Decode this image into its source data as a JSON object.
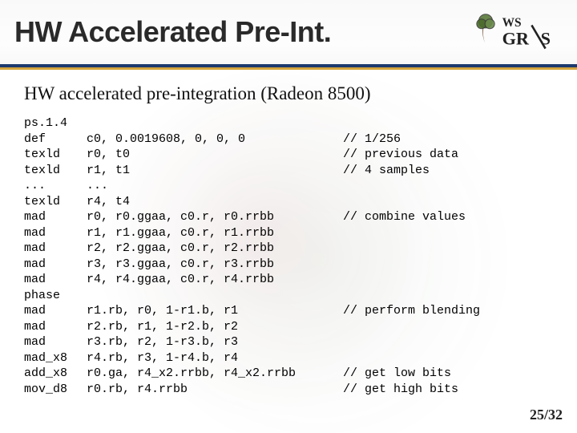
{
  "header": {
    "title": "HW Accelerated Pre-Int.",
    "logo_alt": "WS GRS"
  },
  "subtitle": "HW accelerated pre-integration (Radeon 8500)",
  "code": {
    "rows": [
      {
        "op": "ps.1.4",
        "args": "",
        "cm": ""
      },
      {
        "op": "def",
        "args": "c0, 0.0019608, 0, 0, 0",
        "cm": "// 1/256"
      },
      {
        "op": "texld",
        "args": "r0, t0",
        "cm": "// previous data"
      },
      {
        "op": "texld",
        "args": "r1, t1",
        "cm": "// 4 samples"
      },
      {
        "op": "...",
        "args": "...",
        "cm": ""
      },
      {
        "op": "texld",
        "args": "r4, t4",
        "cm": ""
      },
      {
        "op": "mad",
        "args": "r0, r0.ggaa, c0.r, r0.rrbb",
        "cm": "// combine values"
      },
      {
        "op": "mad",
        "args": "r1, r1.ggaa, c0.r, r1.rrbb",
        "cm": ""
      },
      {
        "op": "mad",
        "args": "r2, r2.ggaa, c0.r, r2.rrbb",
        "cm": ""
      },
      {
        "op": "mad",
        "args": "r3, r3.ggaa, c0.r, r3.rrbb",
        "cm": ""
      },
      {
        "op": "mad",
        "args": "r4, r4.ggaa, c0.r, r4.rrbb",
        "cm": ""
      },
      {
        "op": "phase",
        "args": "",
        "cm": ""
      },
      {
        "op": "mad",
        "args": "r1.rb, r0, 1-r1.b, r1",
        "cm": "// perform blending"
      },
      {
        "op": "mad",
        "args": "r2.rb, r1, 1-r2.b, r2",
        "cm": ""
      },
      {
        "op": "mad",
        "args": "r3.rb, r2, 1-r3.b, r3",
        "cm": ""
      },
      {
        "op": "mad_x8",
        "args": "r4.rb, r3, 1-r4.b, r4",
        "cm": ""
      },
      {
        "op": "add_x8",
        "args": "r0.ga, r4_x2.rrbb, r4_x2.rrbb",
        "cm": "// get low bits"
      },
      {
        "op": "mov_d8",
        "args": "r0.rb, r4.rrbb",
        "cm": "// get high bits"
      }
    ]
  },
  "footer": {
    "page": "25/32"
  }
}
